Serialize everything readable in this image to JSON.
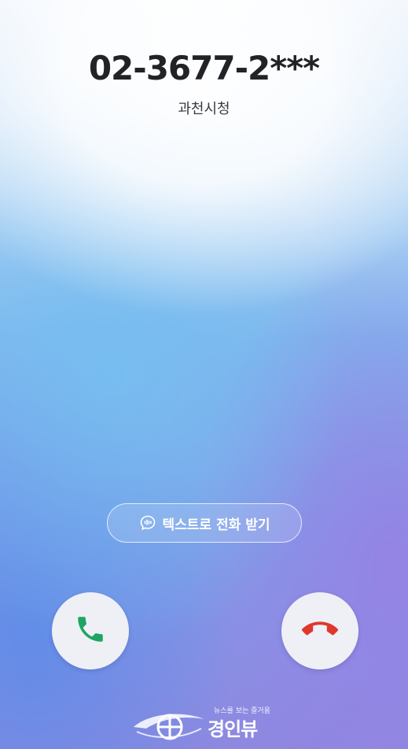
{
  "call": {
    "number": "02-3677-2***",
    "caller_name": "과천시청"
  },
  "actions": {
    "text_answer_label": "텍스트로 전화 받기",
    "accept_icon": "phone-accept-icon",
    "decline_icon": "phone-decline-icon"
  },
  "watermark": {
    "tagline": "뉴스를 보는 즐거움",
    "brand": "경인뷰"
  },
  "colors": {
    "accept": "#1fa463",
    "decline": "#e0372c",
    "text_primary": "#222326"
  }
}
